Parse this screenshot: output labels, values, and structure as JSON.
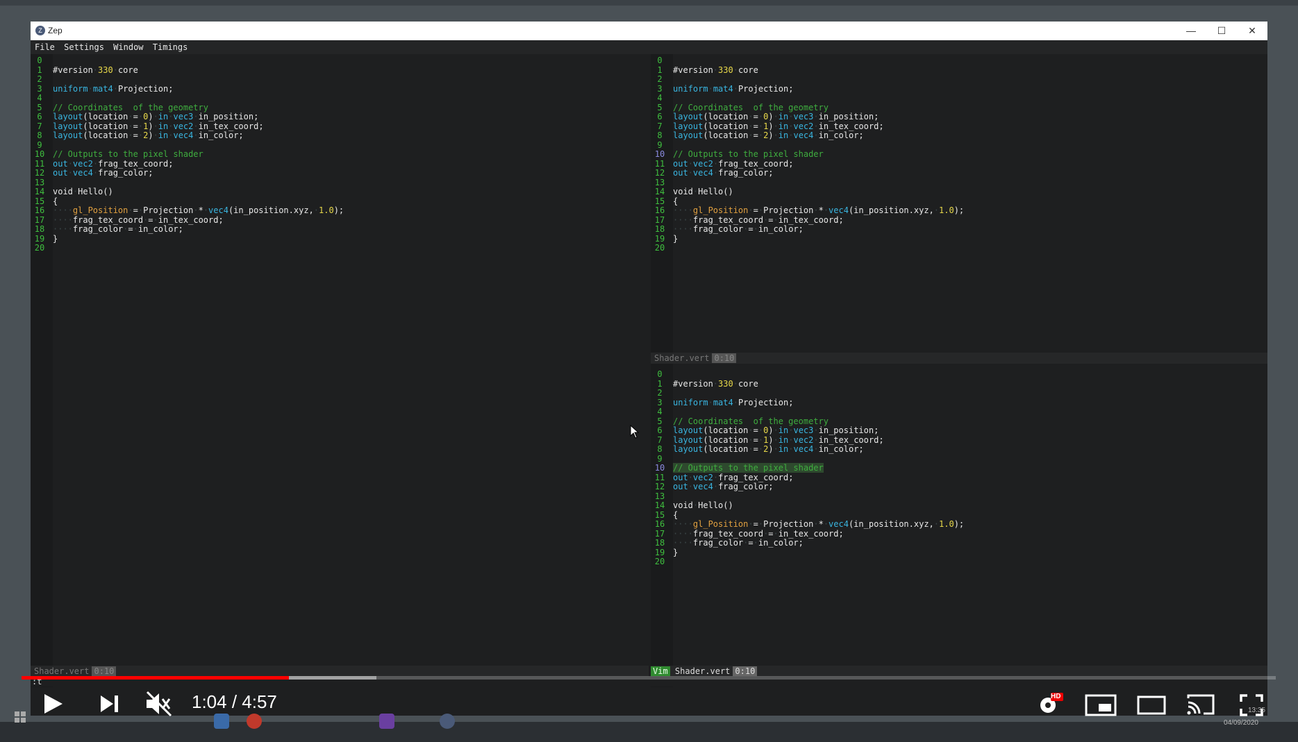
{
  "window": {
    "title": "Zep",
    "minimize": "—",
    "maximize": "☐",
    "close": "✕"
  },
  "menu": [
    "File",
    "Settings",
    "Window",
    "Timings"
  ],
  "code_lines": [
    {
      "n": "0",
      "t": ""
    },
    {
      "n": "1",
      "t": "#version 330 core"
    },
    {
      "n": "2",
      "t": ""
    },
    {
      "n": "3",
      "t": "uniform mat4 Projection;"
    },
    {
      "n": "4",
      "t": ""
    },
    {
      "n": "5",
      "t": "// Coordinates  of the geometry"
    },
    {
      "n": "6",
      "t": "layout(location = 0) in vec3 in_position;"
    },
    {
      "n": "7",
      "t": "layout(location = 1) in vec2 in_tex_coord;"
    },
    {
      "n": "8",
      "t": "layout(location = 2) in vec4 in_color;"
    },
    {
      "n": "9",
      "t": ""
    },
    {
      "n": "10",
      "t": "// Outputs to the pixel shader"
    },
    {
      "n": "11",
      "t": "out vec2 frag_tex_coord;"
    },
    {
      "n": "12",
      "t": "out vec4 frag_color;"
    },
    {
      "n": "13",
      "t": ""
    },
    {
      "n": "14",
      "t": "void Hello()"
    },
    {
      "n": "15",
      "t": "{"
    },
    {
      "n": "16",
      "t": "    gl_Position = Projection * vec4(in_position.xyz, 1.0);"
    },
    {
      "n": "17",
      "t": "    frag_tex_coord = in_tex_coord;"
    },
    {
      "n": "18",
      "t": "    frag_color = in_color;"
    },
    {
      "n": "19",
      "t": "}"
    },
    {
      "n": "20",
      "t": ""
    }
  ],
  "status": {
    "left": {
      "file": "Shader.vert",
      "pos": "0:10"
    },
    "top_right": {
      "file": "Shader.vert",
      "pos": "0:10"
    },
    "bottom_right": {
      "mode": "Vim",
      "file": "Shader.vert",
      "pos": "0:10"
    },
    "command": ":t"
  },
  "player": {
    "time": "1:04 / 4:57",
    "played_fraction": 0.213,
    "loaded_fraction": 0.283,
    "hd_badge": "HD"
  },
  "taskbar": {
    "clock": "13:35",
    "date": "04/09/2020"
  }
}
